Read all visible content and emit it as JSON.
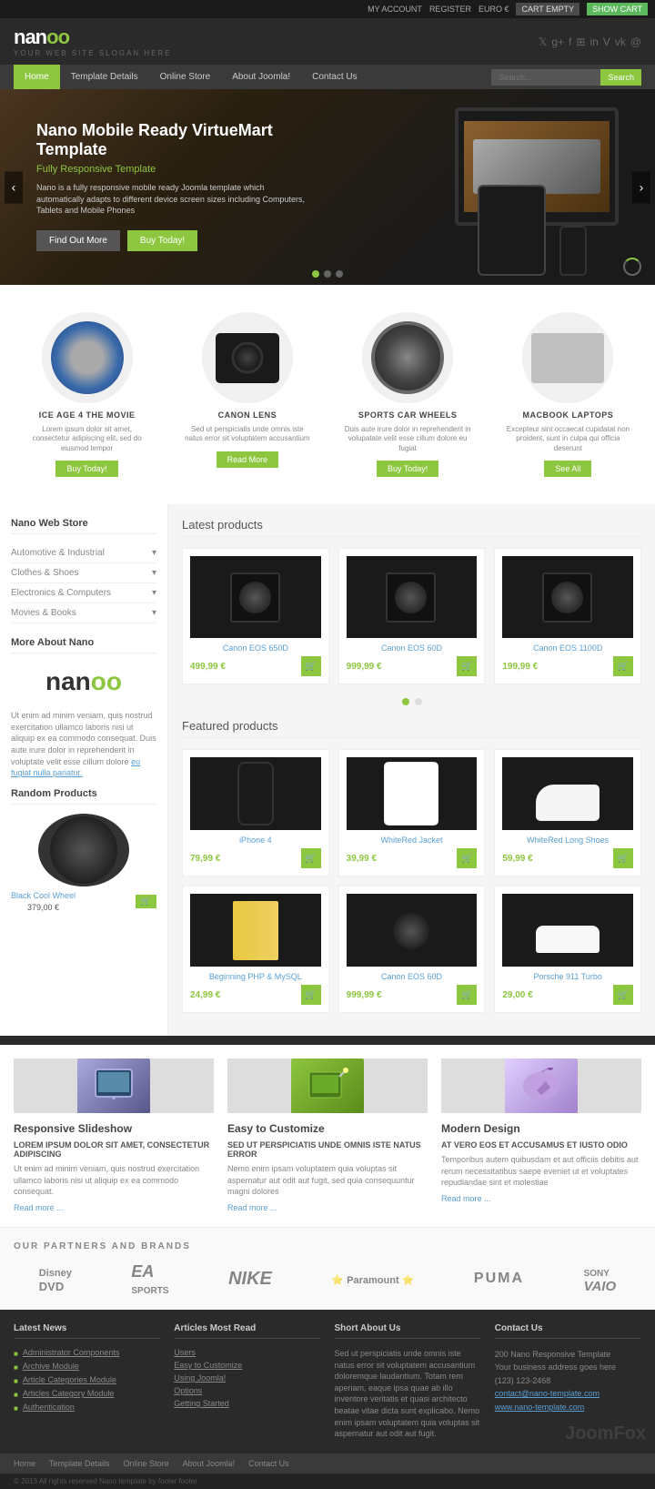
{
  "topbar": {
    "my_account": "MY ACCOUNT",
    "register": "REGISTER",
    "currency": "EURO €",
    "cart_empty": "CART EMPTY",
    "show_cart": "SHOW CART"
  },
  "header": {
    "logo_main": "nano",
    "logo_slogan": "YOUR WEB SITE SLOGAN HERE"
  },
  "nav": {
    "items": [
      {
        "label": "Home",
        "active": true
      },
      {
        "label": "Template Details",
        "active": false
      },
      {
        "label": "Online Store",
        "active": false
      },
      {
        "label": "About Joomla!",
        "active": false
      },
      {
        "label": "Contact Us",
        "active": false
      }
    ],
    "search_placeholder": "Search...",
    "search_btn": "Search"
  },
  "hero": {
    "title": "Nano Mobile Ready VirtueMart Template",
    "subtitle": "Fully Responsive Template",
    "text": "Nano is a fully responsive mobile ready Joomla template which automatically adapts to different device screen sizes including Computers, Tablets and Mobile Phones",
    "btn1": "Find Out More",
    "btn2": "Buy Today!"
  },
  "showcase_products": [
    {
      "name": "ICE AGE 4 THE MOVIE",
      "desc": "Lorem ipsum dolor sit amet, consectetur adipiscing elit, sed do eiusmod tempor",
      "btn": "Buy Today!",
      "type": "disc"
    },
    {
      "name": "CANON LENS",
      "desc": "Sed ut perspiciatis unde omnis iste natus error sit voluptatem accusantium",
      "btn": "Read More",
      "type": "lens"
    },
    {
      "name": "SPORTS CAR WHEELS",
      "desc": "Duis aute irure dolor in reprehenderit in volupatate velit esse cillum dolore eu fugiat",
      "btn": "Buy Today!",
      "type": "wheel"
    },
    {
      "name": "MACBOOK LAPTOPS",
      "desc": "Excepteur sint occaecat cupidatat non proident, sunt in culpa qui officia deserunt",
      "btn": "See All",
      "type": "laptop"
    }
  ],
  "sidebar": {
    "store_title": "Nano Web Store",
    "categories": [
      {
        "label": "Automotive & Industrial"
      },
      {
        "label": "Clothes & Shoes"
      },
      {
        "label": "Electronics & Computers"
      },
      {
        "label": "Movies & Books"
      }
    ],
    "about_title": "More About Nano",
    "about_text": "Ut enim ad minim veniam, quis nostrud exercitation ullamco laboris nisi ut aliquip ex ea commodo consequat. Duis aute irure dolor in reprehenderit in voluptate velit esse cillum dolore ",
    "about_link": "eu fugiat nulla pariatur.",
    "random_title": "Random Products",
    "random_product": {
      "name": "Black Cool Wheel",
      "price": "379,00 €"
    }
  },
  "latest_products": {
    "title": "Latest products",
    "items": [
      {
        "name": "Canon EOS 650D",
        "price": "499,99 €"
      },
      {
        "name": "Canon EOS 60D",
        "price": "999,99 €"
      },
      {
        "name": "Canon EOS 1100D",
        "price": "199,99 €"
      }
    ]
  },
  "featured_products": {
    "title": "Featured products",
    "items": [
      {
        "name": "iPhone 4",
        "price": "79,99 €"
      },
      {
        "name": "WhiteRed Jacket",
        "price": "39,99 €"
      },
      {
        "name": "WhiteRed Long Shoes",
        "price": "59,99 €"
      },
      {
        "name": "Beginning PHP & MySQL",
        "price": "24,99 €"
      },
      {
        "name": "Canon EOS 60D",
        "price": "999,99 €"
      },
      {
        "name": "Porsche 911 Turbo",
        "price": "29,00 €"
      }
    ]
  },
  "features": [
    {
      "title": "Responsive Slideshow",
      "subtitle": "LOREM IPSUM DOLOR SIT AMET, CONSECTETUR ADIPISCING",
      "text": "Ut enim ad minim veniam, quis nostrud exercitation ullamco laboris nisi ut aliquip ex ea commodo consequat.",
      "link": "Read more ..."
    },
    {
      "title": "Easy to Customize",
      "subtitle": "SED UT PERSPICIATIS UNDE OMNIS ISTE NATUS ERROR",
      "text": "Nemo enim ipsam voluptatem quia voluptas sit aspernatur aut odit aut fugit, sed quia consequuntur magni dolores",
      "link": "Read more ..."
    },
    {
      "title": "Modern Design",
      "subtitle": "AT VERO EOS ET ACCUSAMUS ET IUSTO ODIO",
      "text": "Temporibus autem quibusdam et aut officiis debitis aut rerum necessitatibus saepe eveniet ut et voluptates repudiandae sint et molestiae",
      "link": "Read more ..."
    }
  ],
  "partners": {
    "title": "OUR PARTNERS AND BRANDS",
    "logos": [
      "Disney DVD",
      "EA SPORTS",
      "NIKE",
      "Paramount",
      "PUMA",
      "SONY VAIO"
    ]
  },
  "footer": {
    "latest_news_title": "Latest News",
    "news_items": [
      "Administrator Components",
      "Archive Module",
      "Article Categories Module",
      "Articles Category Module",
      "Authentication"
    ],
    "articles_title": "Articles Most Read",
    "articles_items": [
      "Users",
      "Easy to Customize",
      "Using Joomla!",
      "Options",
      "Getting Started"
    ],
    "about_title": "Short About Us",
    "about_text": "Sed ut perspiciatis unde omnis iste natus error sit voluptatem accusantium doloremque laudantium. Totam rem aperiam, eaque ipsa quae ab illo inventore veritatis et quasi architecto beatae vitae dicta sunt explicabo. Nemo enim ipsam voluptatem quia voluptas sit aspernatur aut odit aut fugit.",
    "contact_title": "Contact Us",
    "contact_address": "200 Nano Responsive Template",
    "contact_address2": "Your business address goes here",
    "contact_phone": "(123) 123-2468",
    "contact_email": "contact@nano-template.com",
    "contact_web": "www.nano-template.com"
  },
  "bottom_nav": {
    "items": [
      "Home",
      "Template Details",
      "Online Store",
      "About Joomla!",
      "Contact Us"
    ]
  },
  "copyright": "© 2013 All rights reserved Nano template by footer footer"
}
